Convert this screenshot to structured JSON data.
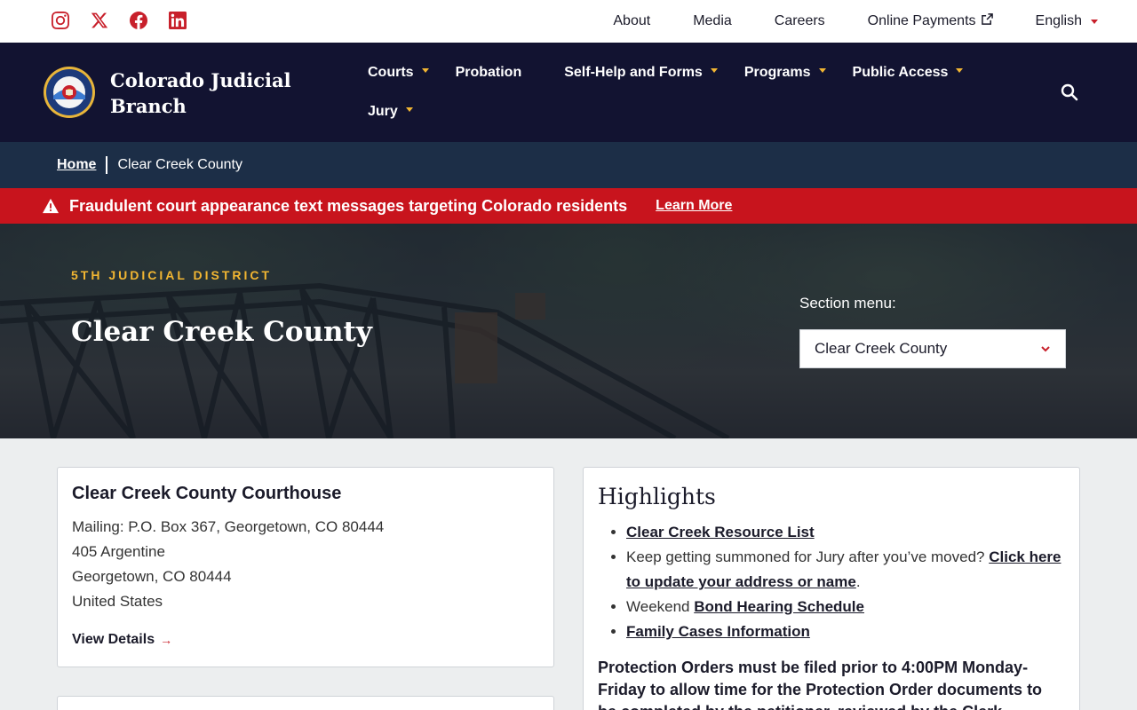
{
  "utility": {
    "social": [
      "instagram-icon",
      "x-icon",
      "facebook-icon",
      "linkedin-icon"
    ],
    "links": [
      "About",
      "Media",
      "Careers",
      "Online Payments"
    ],
    "language": "English"
  },
  "header": {
    "brand": "Colorado Judicial Branch",
    "nav_row1": [
      "Courts",
      "Probation",
      "Self-Help and Forms",
      "Programs",
      "Public Access"
    ],
    "nav_row2": [
      "Jury"
    ]
  },
  "breadcrumb": {
    "home": "Home",
    "current": "Clear Creek County"
  },
  "alert": {
    "text": "Fraudulent court appearance text messages targeting Colorado residents",
    "link": "Learn More"
  },
  "hero": {
    "district": "5TH JUDICIAL DISTRICT",
    "title": "Clear Creek County",
    "section_label": "Section menu:",
    "section_value": "Clear Creek County"
  },
  "courthouse": {
    "title": "Clear Creek County Courthouse",
    "mailing": "Mailing: P.O. Box 367, Georgetown, CO 80444",
    "street": "405 Argentine",
    "city": "Georgetown, CO 80444",
    "country": "United States",
    "details": "View Details"
  },
  "highlights": {
    "title": "Highlights",
    "item1_link": "Clear Creek Resource List",
    "item2_text": "Keep getting summoned for Jury after you’ve moved? ",
    "item2_link": "Click here to update your address or name",
    "item2_end": ".",
    "item3_text": "Weekend ",
    "item3_link": "Bond Hearing Schedule",
    "item4_link": "Family Cases Information",
    "notice": "Protection Orders must be filed prior to 4:00PM Monday-Friday to allow time for the Protection Order documents to be completed by the petitioner, reviewed by the Clerk"
  },
  "colors": {
    "navy": "#121331",
    "breadcrumb": "#1c2e47",
    "alert_red": "#c8141d",
    "gold": "#f2b632",
    "social_red": "#c8202b"
  }
}
